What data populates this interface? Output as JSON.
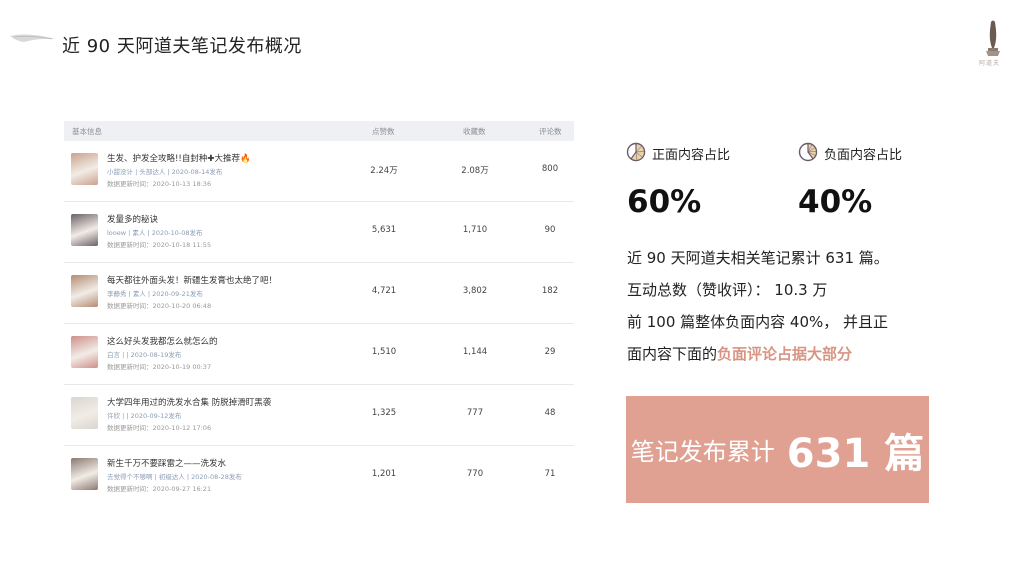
{
  "header": {
    "title": "近 90 天阿道夫笔记发布概况",
    "logo_caption": "阿道夫"
  },
  "table": {
    "columns": [
      "基本信息",
      "点赞数",
      "收藏数",
      "评论数"
    ],
    "rows": [
      {
        "title": "生发、护发全攻略!!自封种✚大推荐🔥",
        "author": "小甜没计 | 头部达人 | 2020-08-14发布",
        "time": "数据更新时间：2020-10-13 18:36",
        "likes": "2.24万",
        "collects": "2.08万",
        "comments": "800",
        "thumb_color": "#c9a28c"
      },
      {
        "title": "发量多的秘诀",
        "author": "looew | 素人 | 2020-10-08发布",
        "time": "数据更新时间：2020-10-18 11:55",
        "likes": "5,631",
        "collects": "1,710",
        "comments": "90",
        "thumb_color": "#6b6168"
      },
      {
        "title": "每天都往外面头发！新疆生发膏也太绝了吧！",
        "author": "李静秀 | 素人 | 2020-09-21发布",
        "time": "数据更新时间：2020-10-20 06:48",
        "likes": "4,721",
        "collects": "3,802",
        "comments": "182",
        "thumb_color": "#b48b73"
      },
      {
        "title": "这么好头发我都怎么就怎么的",
        "author": "白言 | | 2020-08-19发布",
        "time": "数据更新时间：2020-10-19 00:37",
        "likes": "1,510",
        "collects": "1,144",
        "comments": "29",
        "thumb_color": "#cf8f8a"
      },
      {
        "title": "大学四年用过的洗发水合集 防脱掉滑盯黑袭",
        "author": "许欣 | | 2020-09-12发布",
        "time": "数据更新时间：2020-10-12 17:06",
        "likes": "1,325",
        "collects": "777",
        "comments": "48",
        "thumb_color": "#d9d6cf"
      },
      {
        "title": "新生千万不要踩雷之——洗发水",
        "author": "去觉得个不够啊 | 初级达人 | 2020-08-28发布",
        "time": "数据更新时间：2020-09-27 16:21",
        "likes": "1,201",
        "collects": "770",
        "comments": "71",
        "thumb_color": "#8a7a70"
      }
    ]
  },
  "stats": {
    "positive": {
      "label": "正面内容占比",
      "value": "60%",
      "fraction": 0.6
    },
    "negative": {
      "label": "负面内容占比",
      "value": "40%",
      "fraction": 0.4
    }
  },
  "description": {
    "line1": "近 90 天阿道夫相关笔记累计 631 篇。",
    "line2": "互动总数（赞收评）：  10.3 万",
    "line3": "前 100 篇整体负面内容 40%， 并且正",
    "line4_prefix": "面内容下面的",
    "line4_highlight": "负面评论占据大部分"
  },
  "banner": {
    "text": "笔记发布累计",
    "number": "631 篇"
  },
  "colors": {
    "accent": "#e0a192",
    "highlight": "#d99583",
    "pie_fill": "#e8d3a8",
    "pie_line": "#6e5b6e"
  }
}
